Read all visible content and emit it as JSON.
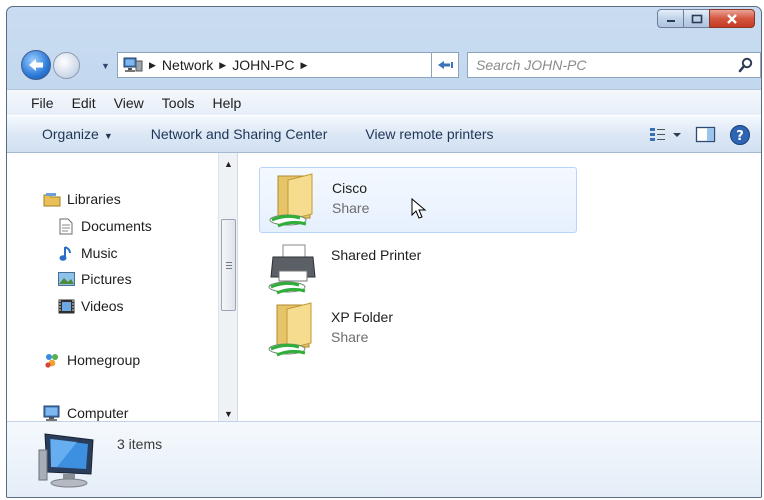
{
  "window": {
    "caption_buttons": [
      "minimize",
      "maximize",
      "close"
    ]
  },
  "address_bar": {
    "crumbs": [
      "Network",
      "JOHN-PC"
    ]
  },
  "search": {
    "placeholder": "Search JOHN-PC"
  },
  "menu": [
    "File",
    "Edit",
    "View",
    "Tools",
    "Help"
  ],
  "commands": {
    "organize": "Organize",
    "network_sharing": "Network and Sharing Center",
    "remote_printers": "View remote printers"
  },
  "nav": {
    "libraries": "Libraries",
    "documents": "Documents",
    "music": "Music",
    "pictures": "Pictures",
    "videos": "Videos",
    "homegroup": "Homegroup",
    "computer": "Computer"
  },
  "items": [
    {
      "name": "Cisco",
      "sub": "Share",
      "icon": "shared-folder-icon"
    },
    {
      "name": "Shared Printer",
      "sub": "",
      "icon": "shared-printer-icon"
    },
    {
      "name": "XP Folder",
      "sub": "Share",
      "icon": "shared-folder-icon"
    }
  ],
  "details": {
    "count": "3 items"
  },
  "colors": {
    "frame": "#b3cbe7",
    "close": "#d4563f",
    "selection": "#e6f0fd",
    "share_arrow": "#2fae3a"
  }
}
